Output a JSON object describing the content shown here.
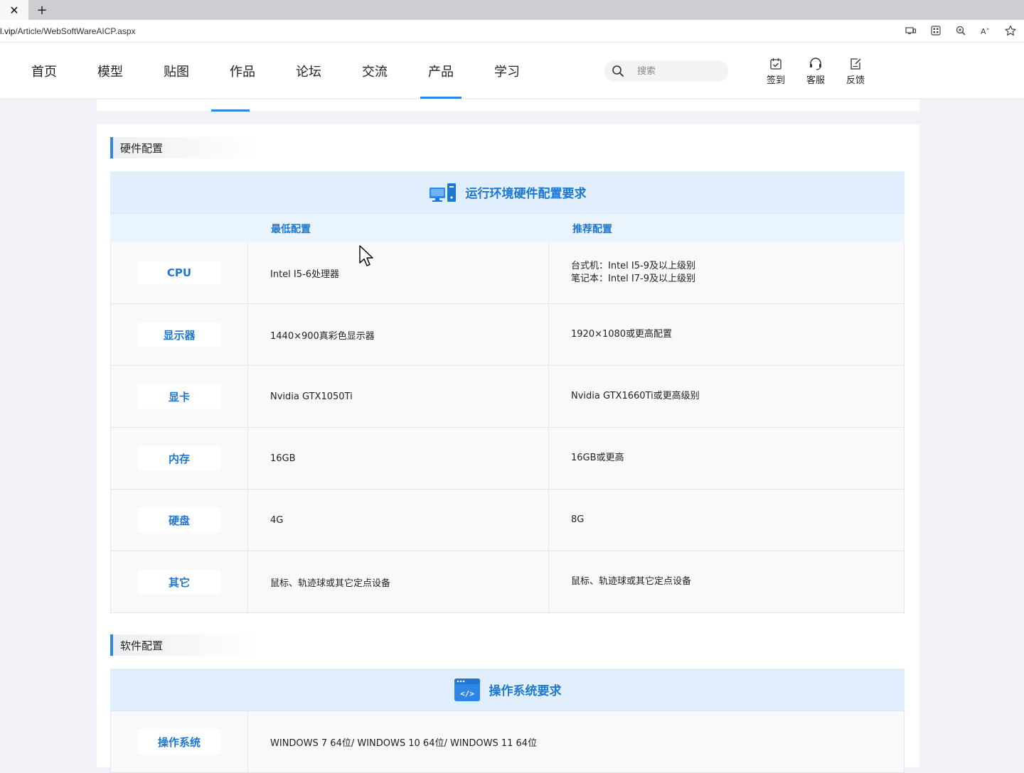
{
  "browser": {
    "url_domain": "l.vip",
    "url_path": "/Article/WebSoftWareAICP.aspx",
    "tab_close_glyph": "✕",
    "new_tab_glyph": "+",
    "toolbar_icons": [
      "reader-mode-icon",
      "apps-icon",
      "zoom-icon",
      "read-aloud-icon",
      "favorite-star-icon"
    ]
  },
  "nav": {
    "items": [
      {
        "label": "首页"
      },
      {
        "label": "模型"
      },
      {
        "label": "贴图"
      },
      {
        "label": "作品"
      },
      {
        "label": "论坛"
      },
      {
        "label": "交流"
      },
      {
        "label": "产品",
        "active": true
      },
      {
        "label": "学习"
      }
    ],
    "search": {
      "placeholder": "搜索"
    },
    "actions": [
      {
        "label": "签到",
        "icon": "checkin-icon"
      },
      {
        "label": "客服",
        "icon": "headset-icon"
      },
      {
        "label": "反馈",
        "icon": "feedback-icon"
      }
    ]
  },
  "hardware": {
    "section_title": "硬件配置",
    "table_title": "运行环境硬件配置要求",
    "col_min": "最低配置",
    "col_rec": "推荐配置",
    "rows": [
      {
        "label": "CPU",
        "min": "Intel I5-6处理器",
        "rec": [
          "台式机：Intel I5-9及以上级别",
          "笔记本：Intel I7-9及以上级别"
        ]
      },
      {
        "label": "显示器",
        "min": "1440×900真彩色显示器",
        "rec": [
          "1920×1080或更高配置"
        ]
      },
      {
        "label": "显卡",
        "min": "Nvidia GTX1050Ti",
        "rec": [
          "Nvidia GTX1660Ti或更高级别"
        ]
      },
      {
        "label": "内存",
        "min": "16GB",
        "rec": [
          "16GB或更高"
        ]
      },
      {
        "label": "硬盘",
        "min": "4G",
        "rec": [
          "8G"
        ]
      },
      {
        "label": "其它",
        "min": "鼠标、轨迹球或其它定点设备",
        "rec": [
          "鼠标、轨迹球或其它定点设备"
        ]
      }
    ]
  },
  "software": {
    "section_title": "软件配置",
    "table_title": "操作系统要求",
    "rows": [
      {
        "label": "操作系统",
        "value": "WINDOWS 7 64位/ WINDOWS 10 64位/ WINDOWS 11 64位"
      }
    ]
  },
  "colors": {
    "accent": "#2e86e6",
    "heading_blue": "#1e78d2",
    "table_header_bg": "#e0effb"
  }
}
